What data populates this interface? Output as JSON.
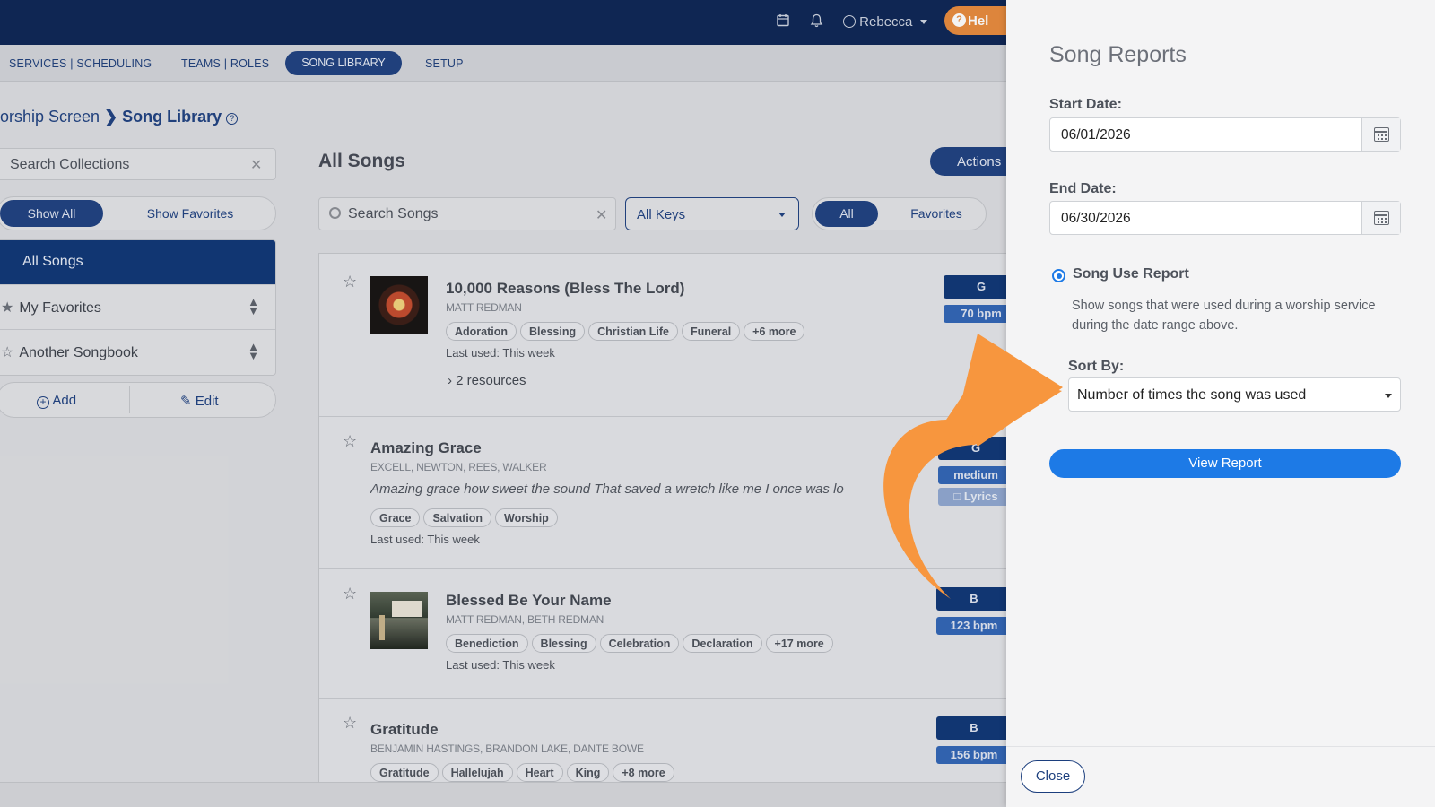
{
  "topbar": {
    "user_name": "Rebecca",
    "help_label": "Hel"
  },
  "subnav": {
    "services": "SERVICES | SCHEDULING",
    "teams": "TEAMS | ROLES",
    "library": "SONG LIBRARY",
    "setup": "SETUP"
  },
  "breadcrumb": {
    "parent": "orship Screen",
    "current": "Song Library"
  },
  "collections": {
    "search_placeholder": "Search Collections",
    "show_all": "Show All",
    "show_favorites": "Show Favorites",
    "items": [
      {
        "label": "All Songs"
      },
      {
        "label": "My Favorites"
      },
      {
        "label": "Another Songbook"
      }
    ],
    "add_label": "Add",
    "edit_label": "Edit"
  },
  "songs_header": {
    "title": "All Songs",
    "actions_label": "Actions",
    "search_placeholder": "Search Songs",
    "keys_selected": "All Keys",
    "filter_all": "All",
    "filter_favorites": "Favorites"
  },
  "songs": [
    {
      "title": "10,000 Reasons (Bless The Lord)",
      "authors": "MATT REDMAN",
      "tags": [
        "Adoration",
        "Blessing",
        "Christian Life",
        "Funeral",
        "+6 more"
      ],
      "last_used": "Last used: This week",
      "resources": "2 resources",
      "key": "G",
      "tempo": "70 bpm"
    },
    {
      "title": "Amazing Grace",
      "authors": "EXCELL, NEWTON, REES, WALKER",
      "lyric": "Amazing grace how sweet the sound That saved a wretch like me I once was lo",
      "tags": [
        "Grace",
        "Salvation",
        "Worship"
      ],
      "last_used": "Last used: This week",
      "key": "G",
      "tempo": "medium",
      "lyrics_badge": "Lyrics"
    },
    {
      "title": "Blessed Be Your Name",
      "authors": "MATT REDMAN, BETH REDMAN",
      "tags": [
        "Benediction",
        "Blessing",
        "Celebration",
        "Declaration",
        "+17 more"
      ],
      "last_used": "Last used: This week",
      "key": "B",
      "tempo": "123 bpm"
    },
    {
      "title": "Gratitude",
      "authors": "BENJAMIN HASTINGS, BRANDON LAKE, DANTE BOWE",
      "tags": [
        "Gratitude",
        "Hallelujah",
        "Heart",
        "King",
        "+8 more"
      ],
      "key": "B",
      "tempo": "156 bpm"
    }
  ],
  "report": {
    "title": "Song Reports",
    "start_label": "Start Date:",
    "start_value": "06/01/2026",
    "end_label": "End Date:",
    "end_value": "06/30/2026",
    "report_type": "Song Use Report",
    "report_desc": "Show songs that were used during a worship service during the date range above.",
    "sort_label": "Sort By:",
    "sort_value": "Number of times the song was used",
    "view_label": "View Report",
    "close_label": "Close"
  },
  "colors": {
    "navy": "#0a2352",
    "accent_blue": "#1d7ae6",
    "arrow_orange": "#f7963e",
    "help_orange": "#e8893a"
  }
}
